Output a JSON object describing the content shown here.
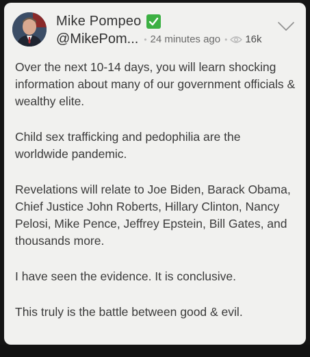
{
  "post": {
    "display_name": "Mike Pompeo",
    "handle": "@MikePom...",
    "time_ago": "24 minutes ago",
    "views": "16k",
    "paragraphs": [
      "Over the next 10-14 days, you will learn shocking information about many of our government officials & wealthy elite.",
      "Child sex trafficking and pedophilia are the worldwide pandemic.",
      "Revelations will relate to Joe Biden, Barack Obama, Chief Justice John Roberts, Hillary Clinton, Nancy Pelosi, Mike Pence, Jeffrey Epstein, Bill Gates, and thousands more.",
      "I have seen the evidence. It is conclusive.",
      "This truly is the battle between good & evil."
    ]
  },
  "icons": {
    "verified": "check-badge-icon",
    "views": "eye-icon",
    "menu": "chevron-down-icon"
  },
  "colors": {
    "card_bg": "#f1f1ef",
    "verified_green": "#3cb043",
    "text": "#3a3a3a",
    "page_bg": "#151515"
  }
}
